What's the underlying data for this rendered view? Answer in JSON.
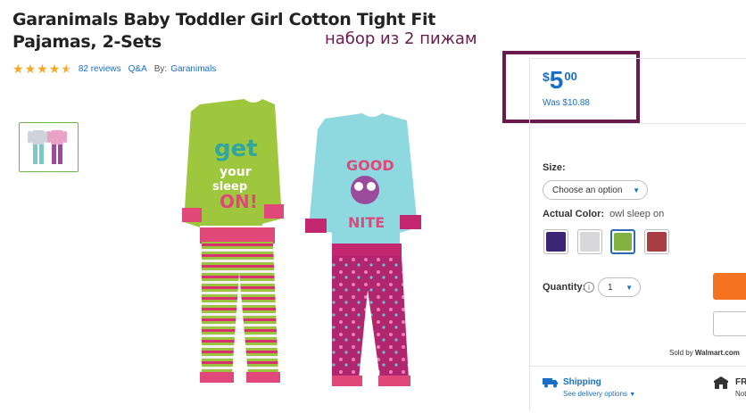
{
  "product": {
    "title": "Garanimals Baby Toddler Girl Cotton Tight Fit Pajamas, 2-Sets",
    "annotation": "набор из 2 пижам",
    "rating": 4.5,
    "reviews_label": "82 reviews",
    "qa_label": "Q&A",
    "by_label": "By:",
    "brand": "Garanimals"
  },
  "price": {
    "currency": "$",
    "dollars": "5",
    "cents": "00",
    "was_label": "Was $10.88"
  },
  "options": {
    "size_label": "Size:",
    "size_placeholder": "Choose an option",
    "color_label": "Actual Color:",
    "color_value": "owl sleep on",
    "swatches": [
      {
        "name": "purple",
        "color": "#3a2675"
      },
      {
        "name": "gray",
        "color": "#d8d8da"
      },
      {
        "name": "green",
        "color": "#82b342"
      },
      {
        "name": "red",
        "color": "#a83e44"
      }
    ],
    "quantity_label": "Quantity:",
    "quantity_value": "1",
    "quantity_info": "i"
  },
  "seller": {
    "sold_by_label": "Sold by",
    "seller_name": "Walmart.com"
  },
  "shipping": {
    "title": "Shipping",
    "link": "See delivery options",
    "store_title": "FRE",
    "store_sub": "Not"
  },
  "colors": {
    "accent": "#1a6fc4",
    "annotation": "#6a1b4d",
    "add_to_cart": "#f47321",
    "star": "#f5a623"
  }
}
